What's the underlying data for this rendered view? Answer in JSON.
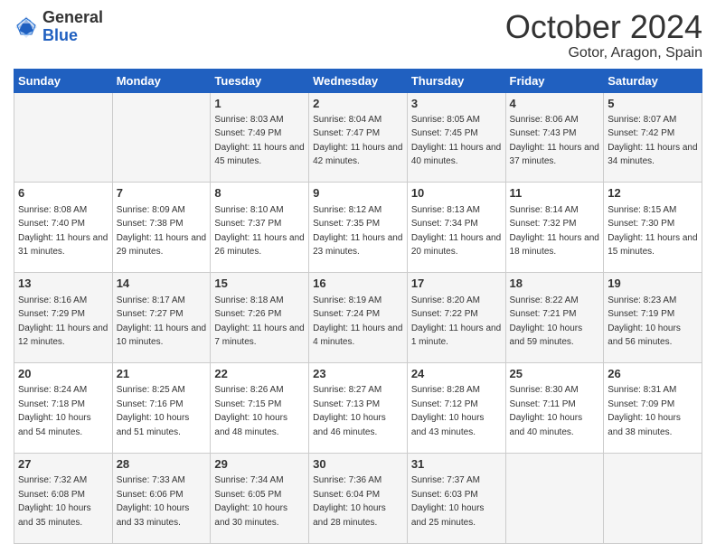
{
  "header": {
    "logo": {
      "general": "General",
      "blue": "Blue"
    },
    "month": "October 2024",
    "location": "Gotor, Aragon, Spain"
  },
  "weekdays": [
    "Sunday",
    "Monday",
    "Tuesday",
    "Wednesday",
    "Thursday",
    "Friday",
    "Saturday"
  ],
  "weeks": [
    [
      null,
      null,
      {
        "day": 1,
        "sunrise": "8:03 AM",
        "sunset": "7:49 PM",
        "daylight": "11 hours and 45 minutes."
      },
      {
        "day": 2,
        "sunrise": "8:04 AM",
        "sunset": "7:47 PM",
        "daylight": "11 hours and 42 minutes."
      },
      {
        "day": 3,
        "sunrise": "8:05 AM",
        "sunset": "7:45 PM",
        "daylight": "11 hours and 40 minutes."
      },
      {
        "day": 4,
        "sunrise": "8:06 AM",
        "sunset": "7:43 PM",
        "daylight": "11 hours and 37 minutes."
      },
      {
        "day": 5,
        "sunrise": "8:07 AM",
        "sunset": "7:42 PM",
        "daylight": "11 hours and 34 minutes."
      }
    ],
    [
      {
        "day": 6,
        "sunrise": "8:08 AM",
        "sunset": "7:40 PM",
        "daylight": "11 hours and 31 minutes."
      },
      {
        "day": 7,
        "sunrise": "8:09 AM",
        "sunset": "7:38 PM",
        "daylight": "11 hours and 29 minutes."
      },
      {
        "day": 8,
        "sunrise": "8:10 AM",
        "sunset": "7:37 PM",
        "daylight": "11 hours and 26 minutes."
      },
      {
        "day": 9,
        "sunrise": "8:12 AM",
        "sunset": "7:35 PM",
        "daylight": "11 hours and 23 minutes."
      },
      {
        "day": 10,
        "sunrise": "8:13 AM",
        "sunset": "7:34 PM",
        "daylight": "11 hours and 20 minutes."
      },
      {
        "day": 11,
        "sunrise": "8:14 AM",
        "sunset": "7:32 PM",
        "daylight": "11 hours and 18 minutes."
      },
      {
        "day": 12,
        "sunrise": "8:15 AM",
        "sunset": "7:30 PM",
        "daylight": "11 hours and 15 minutes."
      }
    ],
    [
      {
        "day": 13,
        "sunrise": "8:16 AM",
        "sunset": "7:29 PM",
        "daylight": "11 hours and 12 minutes."
      },
      {
        "day": 14,
        "sunrise": "8:17 AM",
        "sunset": "7:27 PM",
        "daylight": "11 hours and 10 minutes."
      },
      {
        "day": 15,
        "sunrise": "8:18 AM",
        "sunset": "7:26 PM",
        "daylight": "11 hours and 7 minutes."
      },
      {
        "day": 16,
        "sunrise": "8:19 AM",
        "sunset": "7:24 PM",
        "daylight": "11 hours and 4 minutes."
      },
      {
        "day": 17,
        "sunrise": "8:20 AM",
        "sunset": "7:22 PM",
        "daylight": "11 hours and 1 minute."
      },
      {
        "day": 18,
        "sunrise": "8:22 AM",
        "sunset": "7:21 PM",
        "daylight": "10 hours and 59 minutes."
      },
      {
        "day": 19,
        "sunrise": "8:23 AM",
        "sunset": "7:19 PM",
        "daylight": "10 hours and 56 minutes."
      }
    ],
    [
      {
        "day": 20,
        "sunrise": "8:24 AM",
        "sunset": "7:18 PM",
        "daylight": "10 hours and 54 minutes."
      },
      {
        "day": 21,
        "sunrise": "8:25 AM",
        "sunset": "7:16 PM",
        "daylight": "10 hours and 51 minutes."
      },
      {
        "day": 22,
        "sunrise": "8:26 AM",
        "sunset": "7:15 PM",
        "daylight": "10 hours and 48 minutes."
      },
      {
        "day": 23,
        "sunrise": "8:27 AM",
        "sunset": "7:13 PM",
        "daylight": "10 hours and 46 minutes."
      },
      {
        "day": 24,
        "sunrise": "8:28 AM",
        "sunset": "7:12 PM",
        "daylight": "10 hours and 43 minutes."
      },
      {
        "day": 25,
        "sunrise": "8:30 AM",
        "sunset": "7:11 PM",
        "daylight": "10 hours and 40 minutes."
      },
      {
        "day": 26,
        "sunrise": "8:31 AM",
        "sunset": "7:09 PM",
        "daylight": "10 hours and 38 minutes."
      }
    ],
    [
      {
        "day": 27,
        "sunrise": "7:32 AM",
        "sunset": "6:08 PM",
        "daylight": "10 hours and 35 minutes."
      },
      {
        "day": 28,
        "sunrise": "7:33 AM",
        "sunset": "6:06 PM",
        "daylight": "10 hours and 33 minutes."
      },
      {
        "day": 29,
        "sunrise": "7:34 AM",
        "sunset": "6:05 PM",
        "daylight": "10 hours and 30 minutes."
      },
      {
        "day": 30,
        "sunrise": "7:36 AM",
        "sunset": "6:04 PM",
        "daylight": "10 hours and 28 minutes."
      },
      {
        "day": 31,
        "sunrise": "7:37 AM",
        "sunset": "6:03 PM",
        "daylight": "10 hours and 25 minutes."
      },
      null,
      null
    ]
  ]
}
